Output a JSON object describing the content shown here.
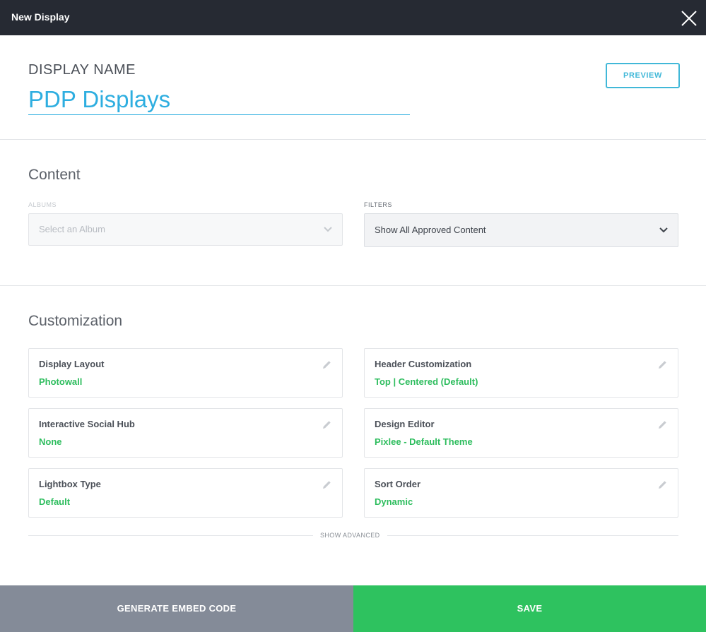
{
  "header": {
    "title": "New Display",
    "close_icon": "close-icon"
  },
  "display_name": {
    "label": "DISPLAY NAME",
    "value": "PDP Displays",
    "preview_label": "PREVIEW"
  },
  "content": {
    "title": "Content",
    "albums": {
      "label": "ALBUMS",
      "placeholder": "Select an Album"
    },
    "filters": {
      "label": "FILTERS",
      "value": "Show All Approved Content"
    }
  },
  "customization": {
    "title": "Customization",
    "cards": [
      {
        "title": "Display Layout",
        "value": "Photowall"
      },
      {
        "title": "Header Customization",
        "value": "Top | Centered (Default)"
      },
      {
        "title": "Interactive Social Hub",
        "value": "None"
      },
      {
        "title": "Design Editor",
        "value": "Pixlee - Default Theme"
      },
      {
        "title": "Lightbox Type",
        "value": "Default"
      },
      {
        "title": "Sort Order",
        "value": "Dynamic"
      }
    ],
    "show_advanced": "SHOW ADVANCED"
  },
  "footer": {
    "generate_label": "GENERATE EMBED CODE",
    "save_label": "SAVE"
  },
  "colors": {
    "topbar": "#262a33",
    "accent_blue": "#2eaee0",
    "accent_green": "#2ec25f",
    "footer_gray": "#848b98"
  }
}
